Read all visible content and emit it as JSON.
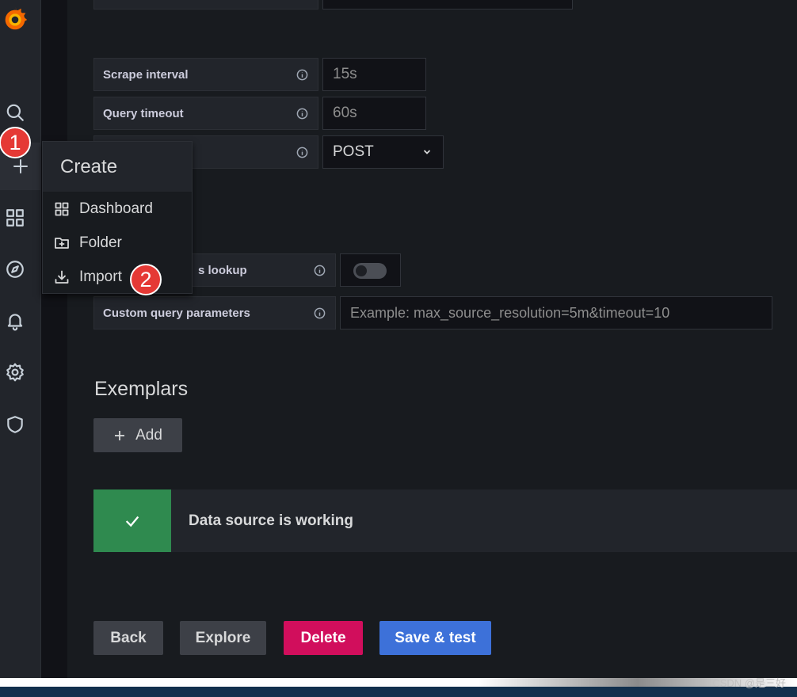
{
  "form": {
    "scrape_interval_label": "Scrape interval",
    "scrape_interval_value": "15s",
    "query_timeout_label": "Query timeout",
    "query_timeout_value": "60s",
    "http_method_value": "POST",
    "series_lookup_label": "s lookup",
    "custom_query_label": "Custom query parameters",
    "custom_query_placeholder": "Example: max_source_resolution=5m&timeout=10"
  },
  "exemplars": {
    "title": "Exemplars",
    "add_label": "Add"
  },
  "alert": {
    "message": "Data source is working"
  },
  "buttons": {
    "back": "Back",
    "explore": "Explore",
    "delete": "Delete",
    "save_test": "Save & test"
  },
  "create_menu": {
    "title": "Create",
    "items": [
      {
        "label": "Dashboard",
        "icon": "apps-icon"
      },
      {
        "label": "Folder",
        "icon": "folder-plus-icon"
      },
      {
        "label": "Import",
        "icon": "import-icon"
      }
    ]
  },
  "annotations": {
    "step1": "1",
    "step2": "2"
  },
  "watermark": "CSDN @是三好",
  "colors": {
    "background": "#181b1f",
    "panel": "#22252b",
    "success": "#2f8a4f",
    "danger": "#d10e5c",
    "primary": "#3d71d9",
    "badge": "#e53935"
  }
}
